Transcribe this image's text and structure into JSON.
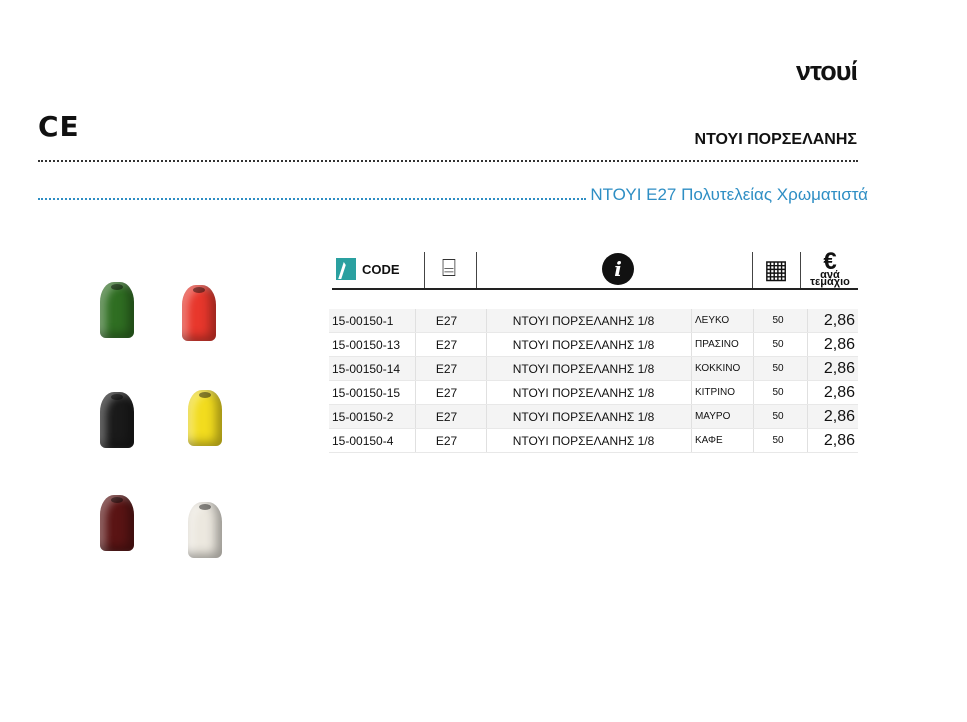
{
  "page_heading": "ντουί",
  "ce_mark": "CE",
  "category_title": "ΝΤΟΥΙ ΠΟΡΣΕΛΑΝΗΣ",
  "product_subtitle": "ΝΤΟΥΙ Ε27 Πολυτελείας Χρωματιστά",
  "table_header": {
    "code_label": "CODE",
    "price_symbol": "€",
    "price_unit_line1": "ανά",
    "price_unit_line2": "τεμάχιο",
    "icons": [
      "code-logo-icon",
      "lamp-base-icon",
      "info-icon",
      "package-box-icon"
    ]
  },
  "colors": {
    "subtitle": "#2e8ec4",
    "code_logo": "#2aa0a0"
  },
  "socket_photos": [
    {
      "color_name": "green",
      "hex": "#2f6e22"
    },
    {
      "color_name": "red",
      "hex": "#e8372c"
    },
    {
      "color_name": "black",
      "hex": "#1a1a1a"
    },
    {
      "color_name": "yellow",
      "hex": "#f2dc1e"
    },
    {
      "color_name": "brown",
      "hex": "#5a1414"
    },
    {
      "color_name": "white",
      "hex": "#ece8df"
    }
  ],
  "products": [
    {
      "code": "15-00150-1",
      "base": "E27",
      "description": "ΝΤΟΥΙ ΠΟΡΣΕΛΑΝΗΣ 1/8",
      "color": "ΛΕΥΚΟ",
      "qty": "50",
      "price": "2,86"
    },
    {
      "code": "15-00150-13",
      "base": "E27",
      "description": "ΝΤΟΥΙ ΠΟΡΣΕΛΑΝΗΣ 1/8",
      "color": "ΠΡΑΣΙΝΟ",
      "qty": "50",
      "price": "2,86"
    },
    {
      "code": "15-00150-14",
      "base": "E27",
      "description": "ΝΤΟΥΙ ΠΟΡΣΕΛΑΝΗΣ 1/8",
      "color": "ΚΟΚΚΙΝΟ",
      "qty": "50",
      "price": "2,86"
    },
    {
      "code": "15-00150-15",
      "base": "E27",
      "description": "ΝΤΟΥΙ ΠΟΡΣΕΛΑΝΗΣ 1/8",
      "color": "ΚΙΤΡΙΝΟ",
      "qty": "50",
      "price": "2,86"
    },
    {
      "code": "15-00150-2",
      "base": "E27",
      "description": "ΝΤΟΥΙ ΠΟΡΣΕΛΑΝΗΣ 1/8",
      "color": "ΜΑΥΡΟ",
      "qty": "50",
      "price": "2,86"
    },
    {
      "code": "15-00150-4",
      "base": "E27",
      "description": "ΝΤΟΥΙ ΠΟΡΣΕΛΑΝΗΣ 1/8",
      "color": "ΚΑΦΕ",
      "qty": "50",
      "price": "2,86"
    }
  ]
}
